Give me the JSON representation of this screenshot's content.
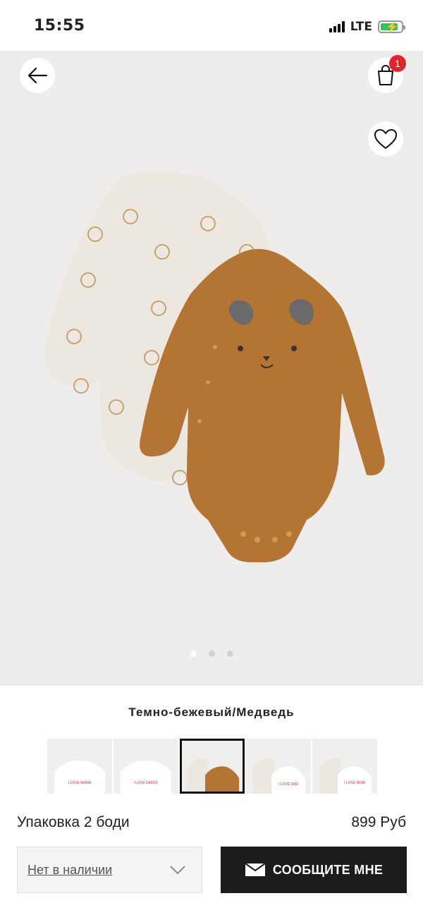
{
  "status_bar": {
    "time": "15:55",
    "network": "LTE"
  },
  "header": {
    "cart_count": "1"
  },
  "gallery": {
    "image_count": 3,
    "active_index": 0
  },
  "product": {
    "color_name": "Темно-бежевый/Медведь",
    "name": "Упаковка 2 боди",
    "price": "899 Руб"
  },
  "swatches": {
    "items": [
      {
        "print": "I LOVE MAMA"
      },
      {
        "print": "I LOVE DADDY"
      },
      {
        "print": ""
      },
      {
        "print": "I LOVE DAD"
      },
      {
        "print": "I LOVE MOM"
      }
    ],
    "selected_index": 2
  },
  "size_selector": {
    "value": "Нет в наличии"
  },
  "notify_button": {
    "label": "СООБЩИТЕ МНЕ"
  },
  "colors": {
    "accent": "#1c1c1c",
    "badge": "#e0242b",
    "bodysuit_brown": "#b47434",
    "bodysuit_cream": "#ece8e0"
  }
}
